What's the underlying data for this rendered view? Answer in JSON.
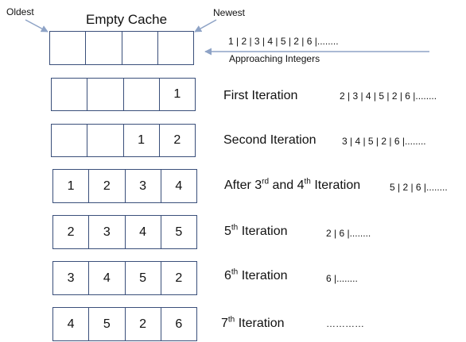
{
  "header": {
    "oldest": "Oldest",
    "newest": "Newest",
    "title": "Empty Cache",
    "approaching_label": "Approaching Integers",
    "approaching_sequence": "1 | 2 | 3 | 4 | 5 | 2 | 6 |........"
  },
  "rows": [
    {
      "cells": [
        "",
        "",
        "",
        ""
      ],
      "label_parts": [],
      "queue": ""
    },
    {
      "cells": [
        "",
        "",
        "",
        "1"
      ],
      "label": "First Iteration",
      "queue": "2 | 3 | 4 | 5 | 2 | 6 |........"
    },
    {
      "cells": [
        "",
        "",
        "1",
        "2"
      ],
      "label": "Second Iteration",
      "queue": "3 | 4 | 5 | 2 | 6 |........"
    },
    {
      "cells": [
        "1",
        "2",
        "3",
        "4"
      ],
      "label_a": "After 3",
      "label_b": "rd",
      "label_c": " and 4",
      "label_d": "th",
      "label_e": " Iteration",
      "queue": "5 | 2 | 6 |........"
    },
    {
      "cells": [
        "2",
        "3",
        "4",
        "5"
      ],
      "label_a": "5",
      "label_b": "th",
      "label_c": " Iteration",
      "queue": "2 | 6 |........"
    },
    {
      "cells": [
        "3",
        "4",
        "5",
        "2"
      ],
      "label_a": "6",
      "label_b": "th",
      "label_c": " Iteration",
      "queue": "6 |........"
    },
    {
      "cells": [
        "4",
        "5",
        "2",
        "6"
      ],
      "label_a": "7",
      "label_b": "th",
      "label_c": " Iteration",
      "queue": "…………"
    }
  ],
  "colors": {
    "box_border": "#3a4f7a",
    "arrow": "#8ea3c6"
  }
}
